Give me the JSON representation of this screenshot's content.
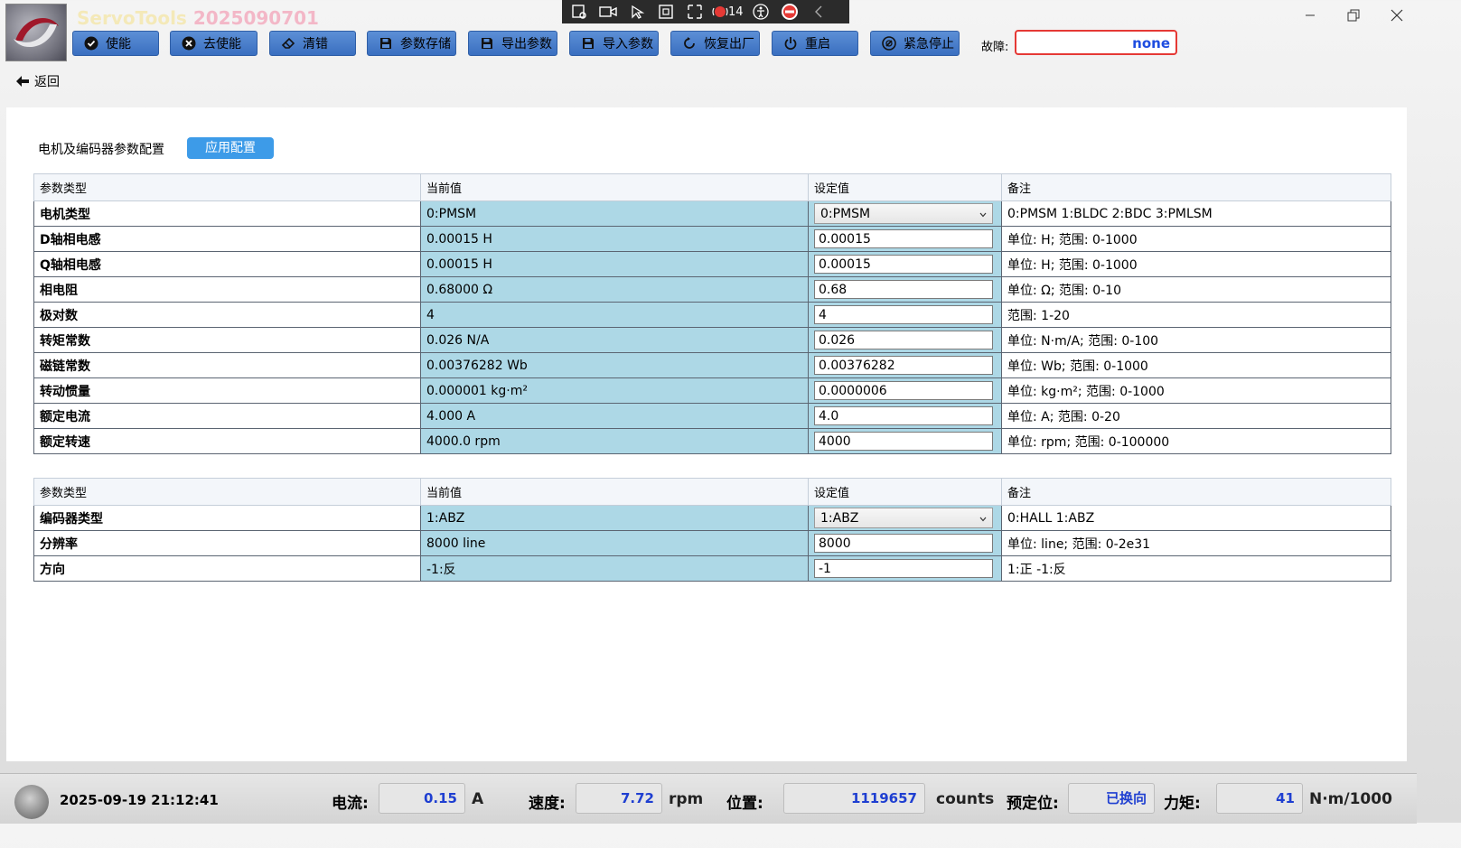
{
  "app": {
    "title_part1": "ServoTools",
    "title_part2": "2025090701"
  },
  "toolbar": {
    "buttons": [
      {
        "label": "使能",
        "icon": "check-circle-icon"
      },
      {
        "label": "去使能",
        "icon": "x-circle-icon"
      },
      {
        "label": "清错",
        "icon": "eraser-icon"
      },
      {
        "label": "参数存储",
        "icon": "floppy-icon"
      },
      {
        "label": "导出参数",
        "icon": "floppy-icon"
      },
      {
        "label": "导入参数",
        "icon": "floppy-icon"
      },
      {
        "label": "恢复出厂",
        "icon": "refresh-icon"
      },
      {
        "label": "重启",
        "icon": "power-icon"
      },
      {
        "label": "紧急停止",
        "icon": "stop-icon"
      }
    ],
    "fault_label": "故障:",
    "fault_value": "none"
  },
  "capture_bar": {
    "count": "14"
  },
  "nav": {
    "back_label": "返回"
  },
  "section": {
    "title": "电机及编码器参数配置",
    "apply_label": "应用配置"
  },
  "headers": [
    "参数类型",
    "当前值",
    "设定值",
    "备注"
  ],
  "motor_rows": [
    {
      "name": "电机类型",
      "current": "0:PMSM",
      "set": "0:PMSM",
      "note": "0:PMSM 1:BLDC 2:BDC 3:PMLSM",
      "select": true
    },
    {
      "name": "D轴相电感",
      "current": "0.00015 H",
      "set": "0.00015",
      "note": "单位: H; 范围: 0-1000"
    },
    {
      "name": "Q轴相电感",
      "current": "0.00015 H",
      "set": "0.00015",
      "note": "单位: H; 范围: 0-1000"
    },
    {
      "name": "相电阻",
      "current": "0.68000 Ω",
      "set": "0.68",
      "note": "单位: Ω; 范围: 0-10"
    },
    {
      "name": "极对数",
      "current": "4",
      "set": "4",
      "note": "范围: 1-20"
    },
    {
      "name": "转矩常数",
      "current": "0.026 N/A",
      "set": "0.026",
      "note": "单位: N·m/A; 范围: 0-100"
    },
    {
      "name": "磁链常数",
      "current": "0.00376282 Wb",
      "set": "0.00376282",
      "note": "单位: Wb; 范围: 0-1000"
    },
    {
      "name": "转动惯量",
      "current": "0.000001 kg·m²",
      "set": "0.0000006",
      "note": "单位: kg·m²; 范围: 0-1000"
    },
    {
      "name": "额定电流",
      "current": "4.000 A",
      "set": "4.0",
      "note": "单位: A; 范围: 0-20"
    },
    {
      "name": "额定转速",
      "current": "4000.0 rpm",
      "set": "4000",
      "note": "单位: rpm; 范围: 0-100000"
    }
  ],
  "encoder_rows": [
    {
      "name": "编码器类型",
      "current": "1:ABZ",
      "set": "1:ABZ",
      "note": "0:HALL 1:ABZ",
      "select": true
    },
    {
      "name": "分辨率",
      "current": "8000 line",
      "set": "8000",
      "note": "单位: line; 范围: 0-2e31"
    },
    {
      "name": "方向",
      "current": "-1:反",
      "set": "-1",
      "note": "1:正 -1:反"
    }
  ],
  "status": {
    "datetime": "2025-09-19 21:12:41",
    "current_label": "电流:",
    "current_value": "0.15",
    "current_unit": "A",
    "speed_label": "速度:",
    "speed_value": "7.72",
    "speed_unit": "rpm",
    "position_label": "位置:",
    "position_value": "1119657",
    "position_unit": "counts",
    "preposition_label": "预定位:",
    "preposition_value": "已换向",
    "torque_label": "力矩:",
    "torque_value": "41",
    "torque_unit": "N·m/1000"
  }
}
